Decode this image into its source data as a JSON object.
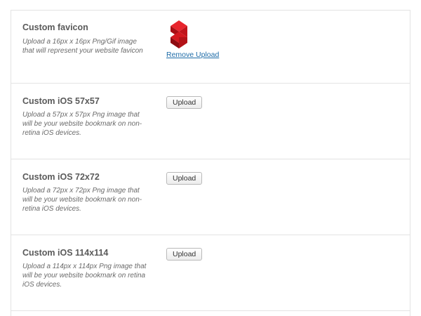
{
  "settings": {
    "rows": [
      {
        "title": "Custom favicon",
        "description": "Upload a 16px x 16px Png/Gif image that will represent your website favicon",
        "image_icon": "favicon-preview-icon",
        "action_label": "Remove Upload"
      },
      {
        "title": "Custom iOS 57x57",
        "description": "Upload a 57px x 57px Png image that will be your website bookmark on non-retina iOS devices.",
        "action_label": "Upload"
      },
      {
        "title": "Custom iOS 72x72",
        "description": "Upload a 72px x 72px Png image that will be your website bookmark on non-retina iOS devices.",
        "action_label": "Upload"
      },
      {
        "title": "Custom iOS 114x114",
        "description": "Upload a 114px x 114px Png image that will be your website bookmark on retina iOS devices.",
        "action_label": "Upload"
      }
    ]
  },
  "colors": {
    "favicon_red": "#d4181f",
    "link": "#1e6ca8"
  }
}
